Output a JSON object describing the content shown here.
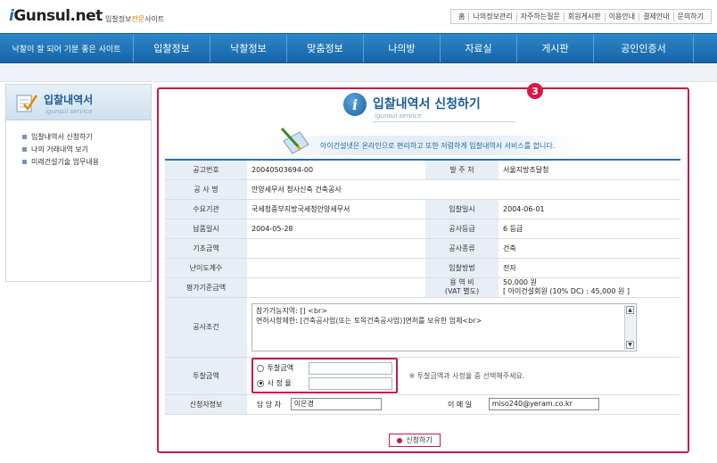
{
  "header": {
    "logo_i": "i",
    "logo_main": "Gunsul",
    "logo_net": ".net",
    "tagline_pre": "입찰정보",
    "tagline_hl": "전문",
    "tagline_post": "사이트",
    "links": [
      "홈",
      "나의정보관리",
      "자주하는질문",
      "회원게시판",
      "이용안내",
      "결제안내",
      "문의하기"
    ]
  },
  "nav": {
    "slogan": "낙찰이 잘 되어 기분 좋은 사이트",
    "items": [
      "입찰정보",
      "낙찰정보",
      "맞춤정보",
      "나의방",
      "자료실",
      "게시판",
      "공인인증서"
    ]
  },
  "sidebar": {
    "title": "입찰내역서",
    "subtitle": "igunsul service",
    "items": [
      "입찰내역서 신청하기",
      "나의 거래내역 보기",
      "미래건설기술 업무내용"
    ]
  },
  "page": {
    "badge": "3",
    "icon_letter": "i",
    "title": "입찰내역서 신청하기",
    "subtitle": "igunsul service",
    "notice": "아이건설넷은 온라인으로 편리하고 또한 저렴하게 입찰내역서 서비스를 합니다."
  },
  "form": {
    "labels": {
      "notice_no": "공고번호",
      "agency": "발 주 처",
      "project": "공 사 명",
      "demand": "수요기관",
      "bid_date": "입찰일시",
      "pay_date": "납품일시",
      "grade": "공사등급",
      "base_price": "기초금액",
      "type": "공사종류",
      "difficulty": "난이도계수",
      "method": "입찰방법",
      "eval_price": "평가기준금액",
      "fee": "용 역 비",
      "fee_sub": "(VAT 별도)",
      "conditions": "공사조건",
      "bid_amount": "투찰금액",
      "applicant": "신청자정보"
    },
    "values": {
      "notice_no": "20040503694-00",
      "agency": "서울지방조달청",
      "project": "안양세무서 청사신축 건축공사",
      "demand": "국세청중부지방국세청안양세무서",
      "bid_date": "2004-06-01",
      "pay_date": "2004-05-28",
      "grade": "6 등급",
      "base_price": "",
      "type": "건축",
      "difficulty": "",
      "method": "전자",
      "eval_price": "",
      "fee_line1": "50,000 원",
      "fee_line2": "[ 아이건설회원 (10% DC) : 45,000 원 ]",
      "conditions_line1": "참가가능지역: [] <br>",
      "conditions_line2": "면허사항제한: [건축공사업(또는 토목건축공사업)]면허를 보유한 업체<br>"
    },
    "bid": {
      "option1": "투찰금액",
      "option2": "사 정 율",
      "selected": "사 정 율",
      "note": "※ 투찰금액과 사정율 중 선택해주세요."
    },
    "applicant": {
      "manager_label": "담 당 자",
      "manager_value": "이은경",
      "email_label": "이 메 일",
      "email_value": "miso240@yeram.co.kr"
    },
    "submit_label": "신청하기"
  },
  "colors": {
    "nav_blue": "#1565a8",
    "accent_red": "#c8184a",
    "label_bg": "#e8eef5"
  }
}
